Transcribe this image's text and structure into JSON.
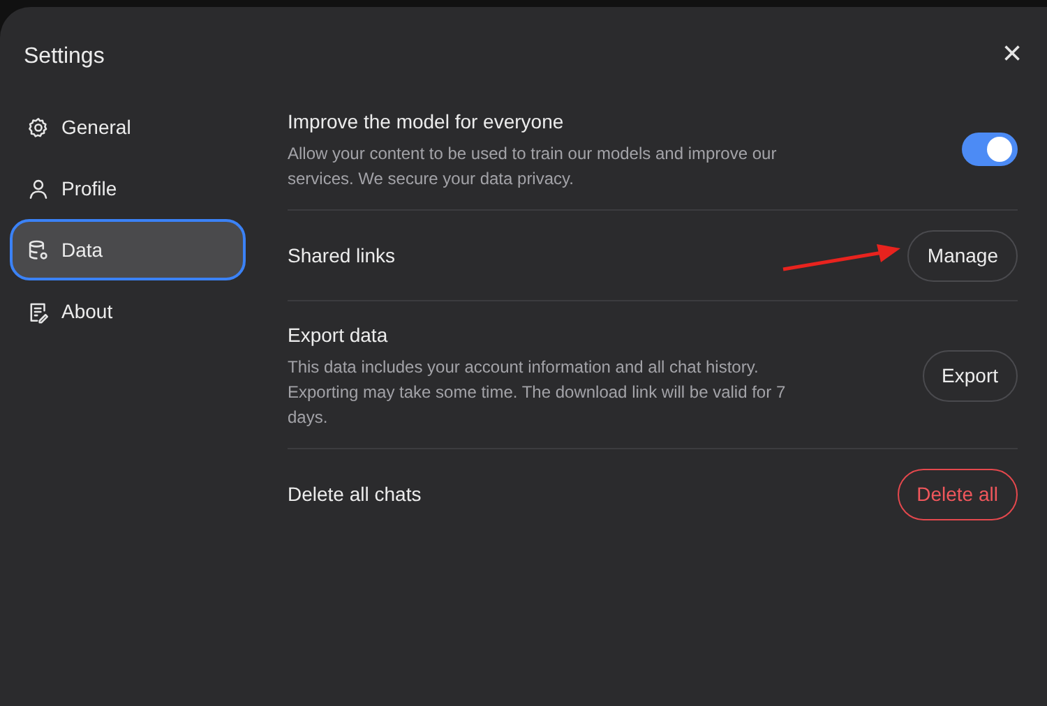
{
  "dialog": {
    "title": "Settings",
    "close": "×"
  },
  "sidebar": {
    "items": [
      {
        "label": "General",
        "selected": false
      },
      {
        "label": "Profile",
        "selected": false
      },
      {
        "label": "Data",
        "selected": true
      },
      {
        "label": "About",
        "selected": false
      }
    ]
  },
  "settings": [
    {
      "kind": "toggle",
      "title": "Improve the model for everyone",
      "description": "Allow your content to be used to train our models and improve our services. We secure your data privacy.",
      "on": true
    },
    {
      "kind": "button",
      "title": "Shared links",
      "button": "Manage",
      "annotated": true
    },
    {
      "kind": "button",
      "title": "Export data",
      "description": "This data includes your account information and all chat history. Exporting may take some time. The download link will be valid for 7 days.",
      "button": "Export"
    },
    {
      "kind": "danger-button",
      "title": "Delete all chats",
      "button": "Delete all"
    }
  ]
}
